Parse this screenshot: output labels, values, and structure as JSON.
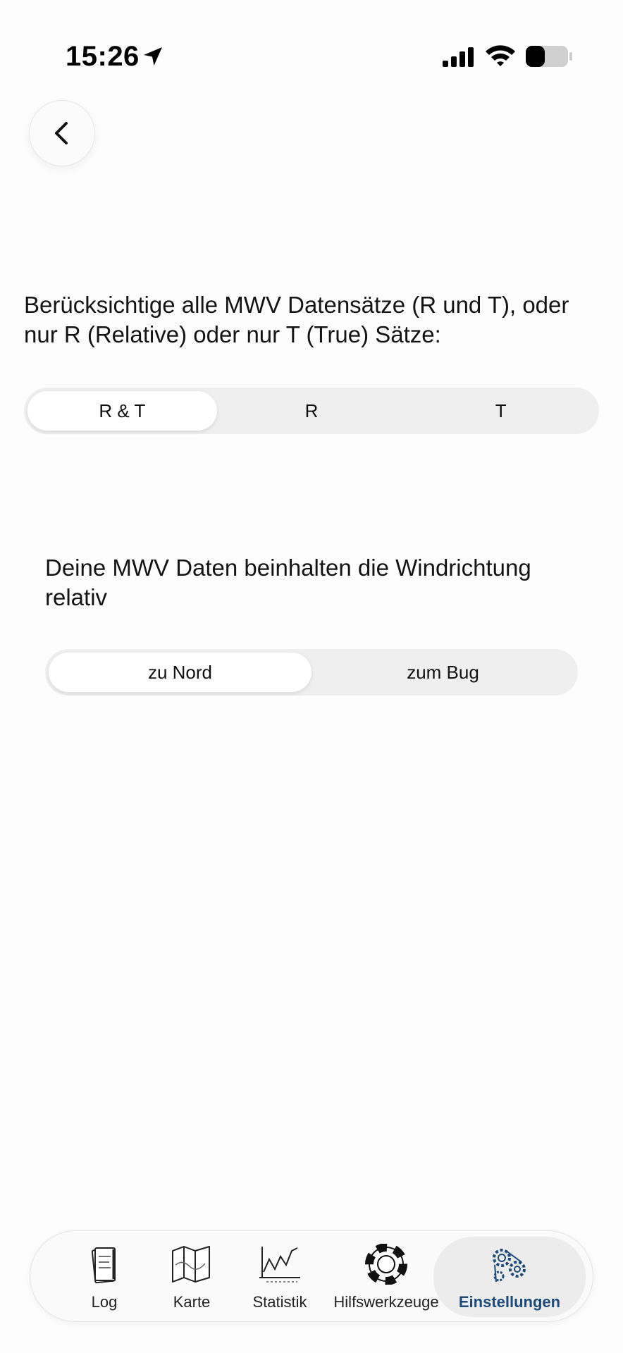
{
  "status_bar": {
    "time": "15:26",
    "location_icon": "location-arrow-icon",
    "signal_icon": "cellular-signal-icon",
    "wifi_icon": "wifi-icon",
    "battery_icon": "battery-icon",
    "battery_level": 0.45
  },
  "navigation": {
    "back_icon": "chevron-left-icon"
  },
  "mwv_records": {
    "description": "Berücksichtige alle MWV Datensätze (R und T), oder nur R (Relative) oder nur T (True) Sätze:",
    "options": [
      "R & T",
      "R",
      "T"
    ],
    "selected_index": 0
  },
  "wind_direction": {
    "description": "Deine MWV Daten beinhalten die Windrichtung relativ",
    "options": [
      "zu Nord",
      "zum Bug"
    ],
    "selected_index": 0
  },
  "tab_bar": {
    "items": [
      {
        "label": "Log",
        "icon": "logbook-icon"
      },
      {
        "label": "Karte",
        "icon": "map-icon"
      },
      {
        "label": "Statistik",
        "icon": "chart-icon"
      },
      {
        "label": "Hilfswerkzeuge",
        "icon": "lifebuoy-icon"
      },
      {
        "label": "Einstellungen",
        "icon": "gears-icon"
      }
    ],
    "active_index": 4,
    "accent_color": "#1d4a78"
  }
}
